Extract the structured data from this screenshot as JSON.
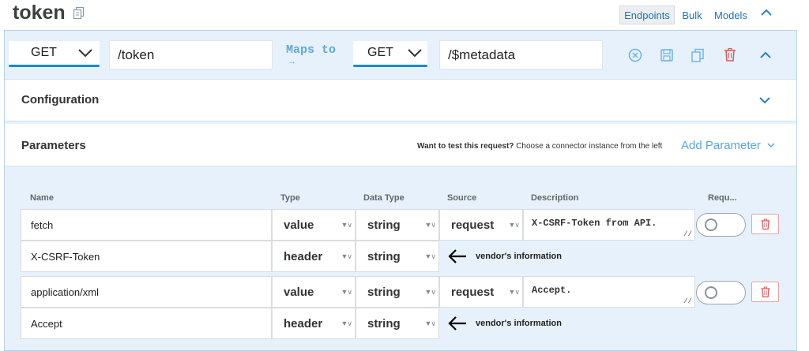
{
  "header": {
    "title": "token",
    "tabs": {
      "endpoints": "Endpoints",
      "bulk": "Bulk",
      "models": "Models"
    }
  },
  "endpoint": {
    "method": "GET",
    "path": "/token",
    "maps_to_label": "Maps to",
    "maps_to_arrow": "→",
    "target_method": "GET",
    "target_path": "/$metadata"
  },
  "sections": {
    "configuration": "Configuration",
    "parameters": "Parameters",
    "test_hint_bold": "Want to test this request?",
    "test_hint_rest": "Choose a connector instance from the left",
    "add_parameter": "Add Parameter"
  },
  "table": {
    "headers": [
      "Name",
      "Type",
      "Data Type",
      "Source",
      "Description",
      "Requ..."
    ],
    "rows": [
      {
        "name": "fetch",
        "type": "value",
        "data_type": "string",
        "source": "request",
        "description": "X-CSRF-Token from API."
      },
      {
        "name": "X-CSRF-Token",
        "type": "header",
        "data_type": "string",
        "annotation": "vendor's information"
      },
      {
        "name": "application/xml",
        "type": "value",
        "data_type": "string",
        "source": "request",
        "description": "Accept."
      },
      {
        "name": "Accept",
        "type": "header",
        "data_type": "string",
        "annotation": "vendor's information"
      }
    ]
  },
  "colors": {
    "accent": "#1c87d6",
    "link": "#5aa5de",
    "danger": "#e05a5a",
    "panel_bg": "#e6f1fb"
  },
  "icons": [
    "copy-icon",
    "chevron-up-icon",
    "chevron-down-icon",
    "close-circle-icon",
    "save-icon",
    "duplicate-icon",
    "trash-icon",
    "left-arrow-icon"
  ]
}
